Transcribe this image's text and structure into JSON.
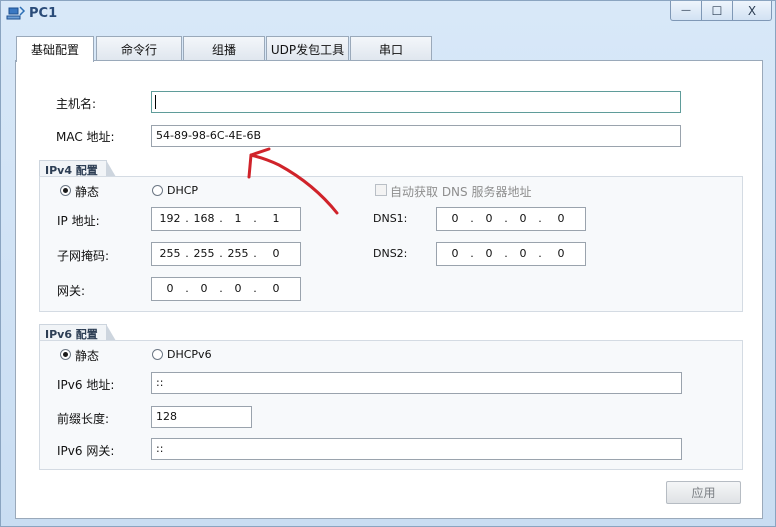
{
  "window": {
    "title": "PC1",
    "minimize_glyph": "—",
    "maximize_glyph": "☐",
    "close_glyph": "X"
  },
  "tabs": [
    {
      "label": "基础配置",
      "active": true
    },
    {
      "label": "命令行",
      "active": false
    },
    {
      "label": "组播",
      "active": false
    },
    {
      "label": "UDP发包工具",
      "active": false
    },
    {
      "label": "串口",
      "active": false
    }
  ],
  "basic": {
    "hostname_label": "主机名:",
    "hostname_value": "",
    "mac_label": "MAC 地址:",
    "mac_value": "54-89-98-6C-4E-6B"
  },
  "ipv4": {
    "section_title": "IPv4 配置",
    "static_label": "静态",
    "dhcp_label": "DHCP",
    "static_selected": true,
    "auto_dns_label": "自动获取 DNS 服务器地址",
    "ip_label": "IP 地址:",
    "ip": [
      "192",
      "168",
      "1",
      "1"
    ],
    "mask_label": "子网掩码:",
    "mask": [
      "255",
      "255",
      "255",
      "0"
    ],
    "gateway_label": "网关:",
    "gateway": [
      "0",
      "0",
      "0",
      "0"
    ],
    "dns1_label": "DNS1:",
    "dns1": [
      "0",
      "0",
      "0",
      "0"
    ],
    "dns2_label": "DNS2:",
    "dns2": [
      "0",
      "0",
      "0",
      "0"
    ]
  },
  "ipv6": {
    "section_title": "IPv6 配置",
    "static_label": "静态",
    "dhcp_label": "DHCPv6",
    "static_selected": true,
    "addr_label": "IPv6 地址:",
    "addr_value": "::",
    "prefix_label": "前缀长度:",
    "prefix_value": "128",
    "gateway_label": "IPv6 网关:",
    "gateway_value": "::"
  },
  "apply_label": "应用",
  "colors": {
    "annotation": "#d0232a",
    "focus_border": "#5f9c9a",
    "title_text": "#2a4b78"
  },
  "annotation": {
    "type": "hand-drawn-arrow",
    "points_to": "mac-address-field"
  }
}
